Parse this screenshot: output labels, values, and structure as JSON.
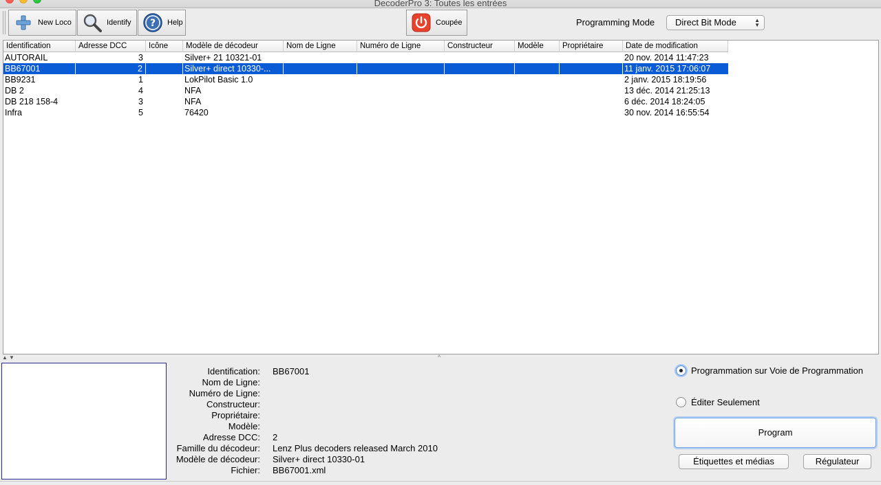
{
  "window": {
    "title": "DecoderPro 3: Toutes les entrées"
  },
  "toolbar": {
    "new_loco_label": "New Loco",
    "identify_label": "Identify",
    "help_label": "Help",
    "power_label": "Coupée",
    "programming_mode_label": "Programming Mode",
    "programming_mode_value": "Direct Bit Mode"
  },
  "table": {
    "columns": [
      "Identification",
      "Adresse DCC",
      "Icône",
      "Modèle de décodeur",
      "Nom de Ligne",
      "Numéro de Ligne",
      "Constructeur",
      "Modèle",
      "Propriétaire",
      "Date de modification"
    ],
    "rows": [
      {
        "id": "AUTORAIL",
        "dcc": "3",
        "icon": "",
        "model": "Silver+ 21 10321-01",
        "line_name": "",
        "line_number": "",
        "builder": "",
        "type": "",
        "owner": "",
        "date": "20 nov. 2014 11:47:23"
      },
      {
        "id": "BB67001",
        "dcc": "2",
        "icon": "",
        "model": "Silver+ direct 10330-...",
        "line_name": "",
        "line_number": "",
        "builder": "",
        "type": "",
        "owner": "",
        "date": "11 janv. 2015 17:06:07"
      },
      {
        "id": "BB9231",
        "dcc": "1",
        "icon": "",
        "model": "LokPilot Basic 1.0",
        "line_name": "",
        "line_number": "",
        "builder": "",
        "type": "",
        "owner": "",
        "date": "2 janv. 2015 18:19:56"
      },
      {
        "id": "DB 2",
        "dcc": "4",
        "icon": "",
        "model": "NFA",
        "line_name": "",
        "line_number": "",
        "builder": "",
        "type": "",
        "owner": "",
        "date": "13 déc. 2014 21:25:13"
      },
      {
        "id": "DB 218 158-4",
        "dcc": "3",
        "icon": "",
        "model": "NFA",
        "line_name": "",
        "line_number": "",
        "builder": "",
        "type": "",
        "owner": "",
        "date": "6 déc. 2014 18:24:05"
      },
      {
        "id": "Infra",
        "dcc": "5",
        "icon": "",
        "model": "76420",
        "line_name": "",
        "line_number": "",
        "builder": "",
        "type": "",
        "owner": "",
        "date": "30 nov. 2014 16:55:54"
      }
    ],
    "selected_row": 1
  },
  "details": {
    "labels": {
      "identification": "Identification:",
      "line_name": "Nom de Ligne:",
      "line_number": "Numéro de Ligne:",
      "builder": "Constructeur:",
      "owner": "Propriétaire:",
      "model": "Modèle:",
      "dcc": "Adresse DCC:",
      "family": "Famille du décodeur:",
      "decoder_model": "Modèle de décodeur:",
      "file": "Fichier:"
    },
    "values": {
      "identification": "BB67001",
      "line_name": "",
      "line_number": "",
      "builder": "",
      "owner": "",
      "model": "",
      "dcc": "2",
      "family": "Lenz Plus decoders released March 2010",
      "decoder_model": "Silver+ direct 10330-01",
      "file": "BB67001.xml"
    }
  },
  "right_panel": {
    "radio_program_track": "Programmation sur Voie de Programmation",
    "radio_edit_only": "Éditer Seulement",
    "program_button": "Program",
    "labels_media_button": "Étiquettes et médias",
    "throttle_button": "Régulateur"
  },
  "colors": {
    "selection": "#0a5cd6",
    "power_red": "#e8412c"
  }
}
